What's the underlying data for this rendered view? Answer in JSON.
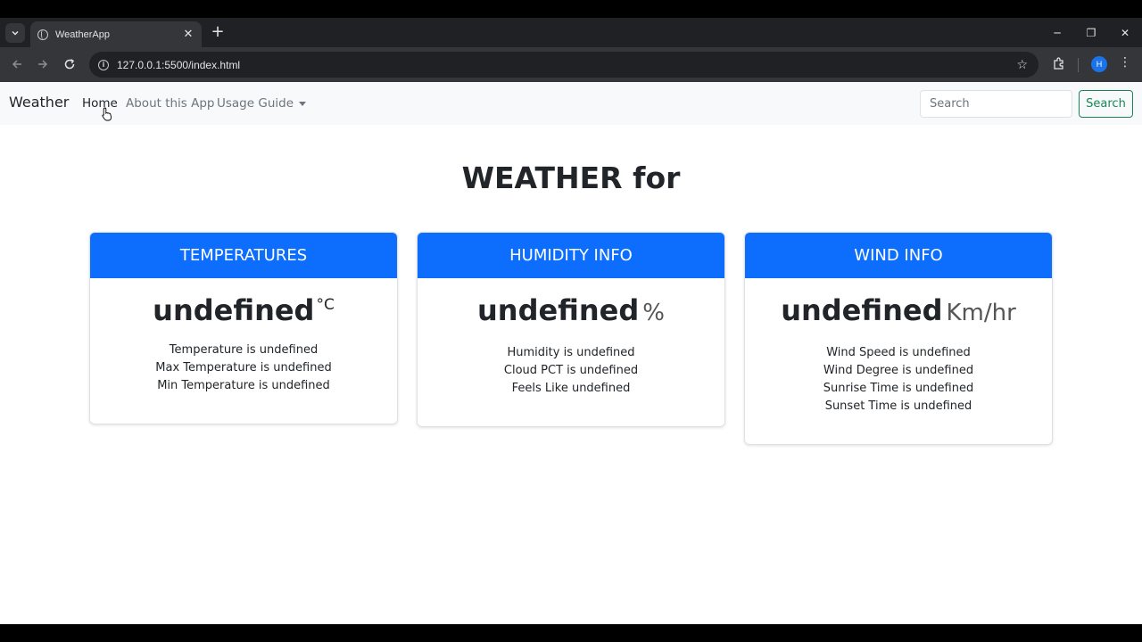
{
  "browser": {
    "tab_title": "WeatherApp",
    "url": "127.0.0.1:5500/index.html",
    "profile_initial": "H"
  },
  "navbar": {
    "brand": "Weather",
    "links": [
      "Home",
      "About this App",
      "Usage Guide"
    ],
    "search_placeholder": "Search",
    "search_button": "Search"
  },
  "main": {
    "heading": "WEATHER for",
    "cards": [
      {
        "title": "TEMPERATURES",
        "value": "undefined",
        "unit": "°C",
        "details": [
          "Temperature is undefined",
          "Max Temperature is undefined",
          "Min Temperature is undefined"
        ]
      },
      {
        "title": "HUMIDITY INFO",
        "value": "undefined",
        "unit": "%",
        "details": [
          "Humidity is undefined",
          "Cloud PCT is undefined",
          "Feels Like undefined"
        ]
      },
      {
        "title": "WIND INFO",
        "value": "undefined",
        "unit": "Km/hr",
        "details": [
          "Wind Speed is undefined",
          "Wind Degree is undefined",
          "Sunrise Time is undefined",
          "Sunset Time is undefined"
        ]
      }
    ]
  },
  "colors": {
    "primary": "#0d6efd",
    "success": "#198754",
    "navbar_bg": "#f8f9fa"
  }
}
